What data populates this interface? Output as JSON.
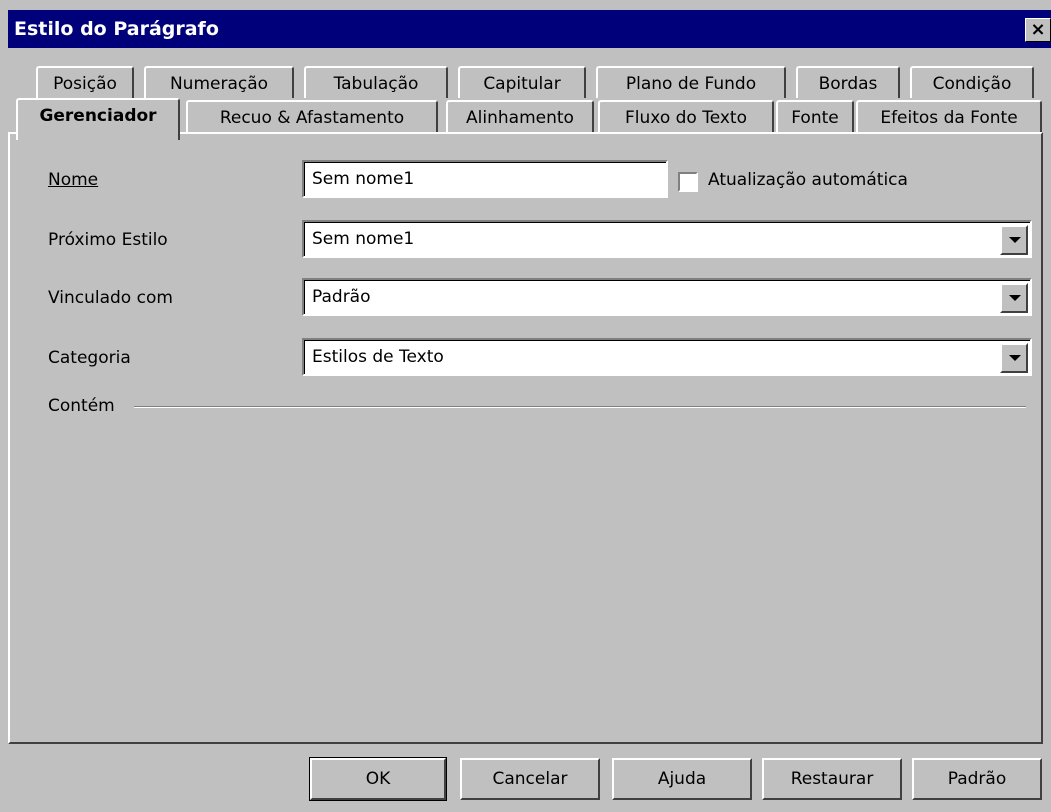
{
  "window": {
    "title": "Estilo do Parágrafo",
    "close_label": "×"
  },
  "tabs_row1": [
    "Posição",
    "Numeração",
    "Tabulação",
    "Capitular",
    "Plano de Fundo",
    "Bordas",
    "Condição"
  ],
  "tabs_row2": [
    "Gerenciador",
    "Recuo & Afastamento",
    "Alinhamento",
    "Fluxo do Texto",
    "Fonte",
    "Efeitos da Fonte"
  ],
  "active_tab": "Gerenciador",
  "form": {
    "name_label": "Nome",
    "name_value": "Sem nome1",
    "auto_update_label": "Atualização automática",
    "auto_update_checked": false,
    "next_style_label": "Próximo Estilo",
    "next_style_value": "Sem nome1",
    "linked_label": "Vinculado com",
    "linked_value": "Padrão",
    "category_label": "Categoria",
    "category_value": "Estilos de Texto",
    "contains_label": "Contém"
  },
  "buttons": {
    "ok": "OK",
    "cancel": "Cancelar",
    "help": "Ajuda",
    "reset": "Restaurar",
    "default": "Padrão"
  }
}
